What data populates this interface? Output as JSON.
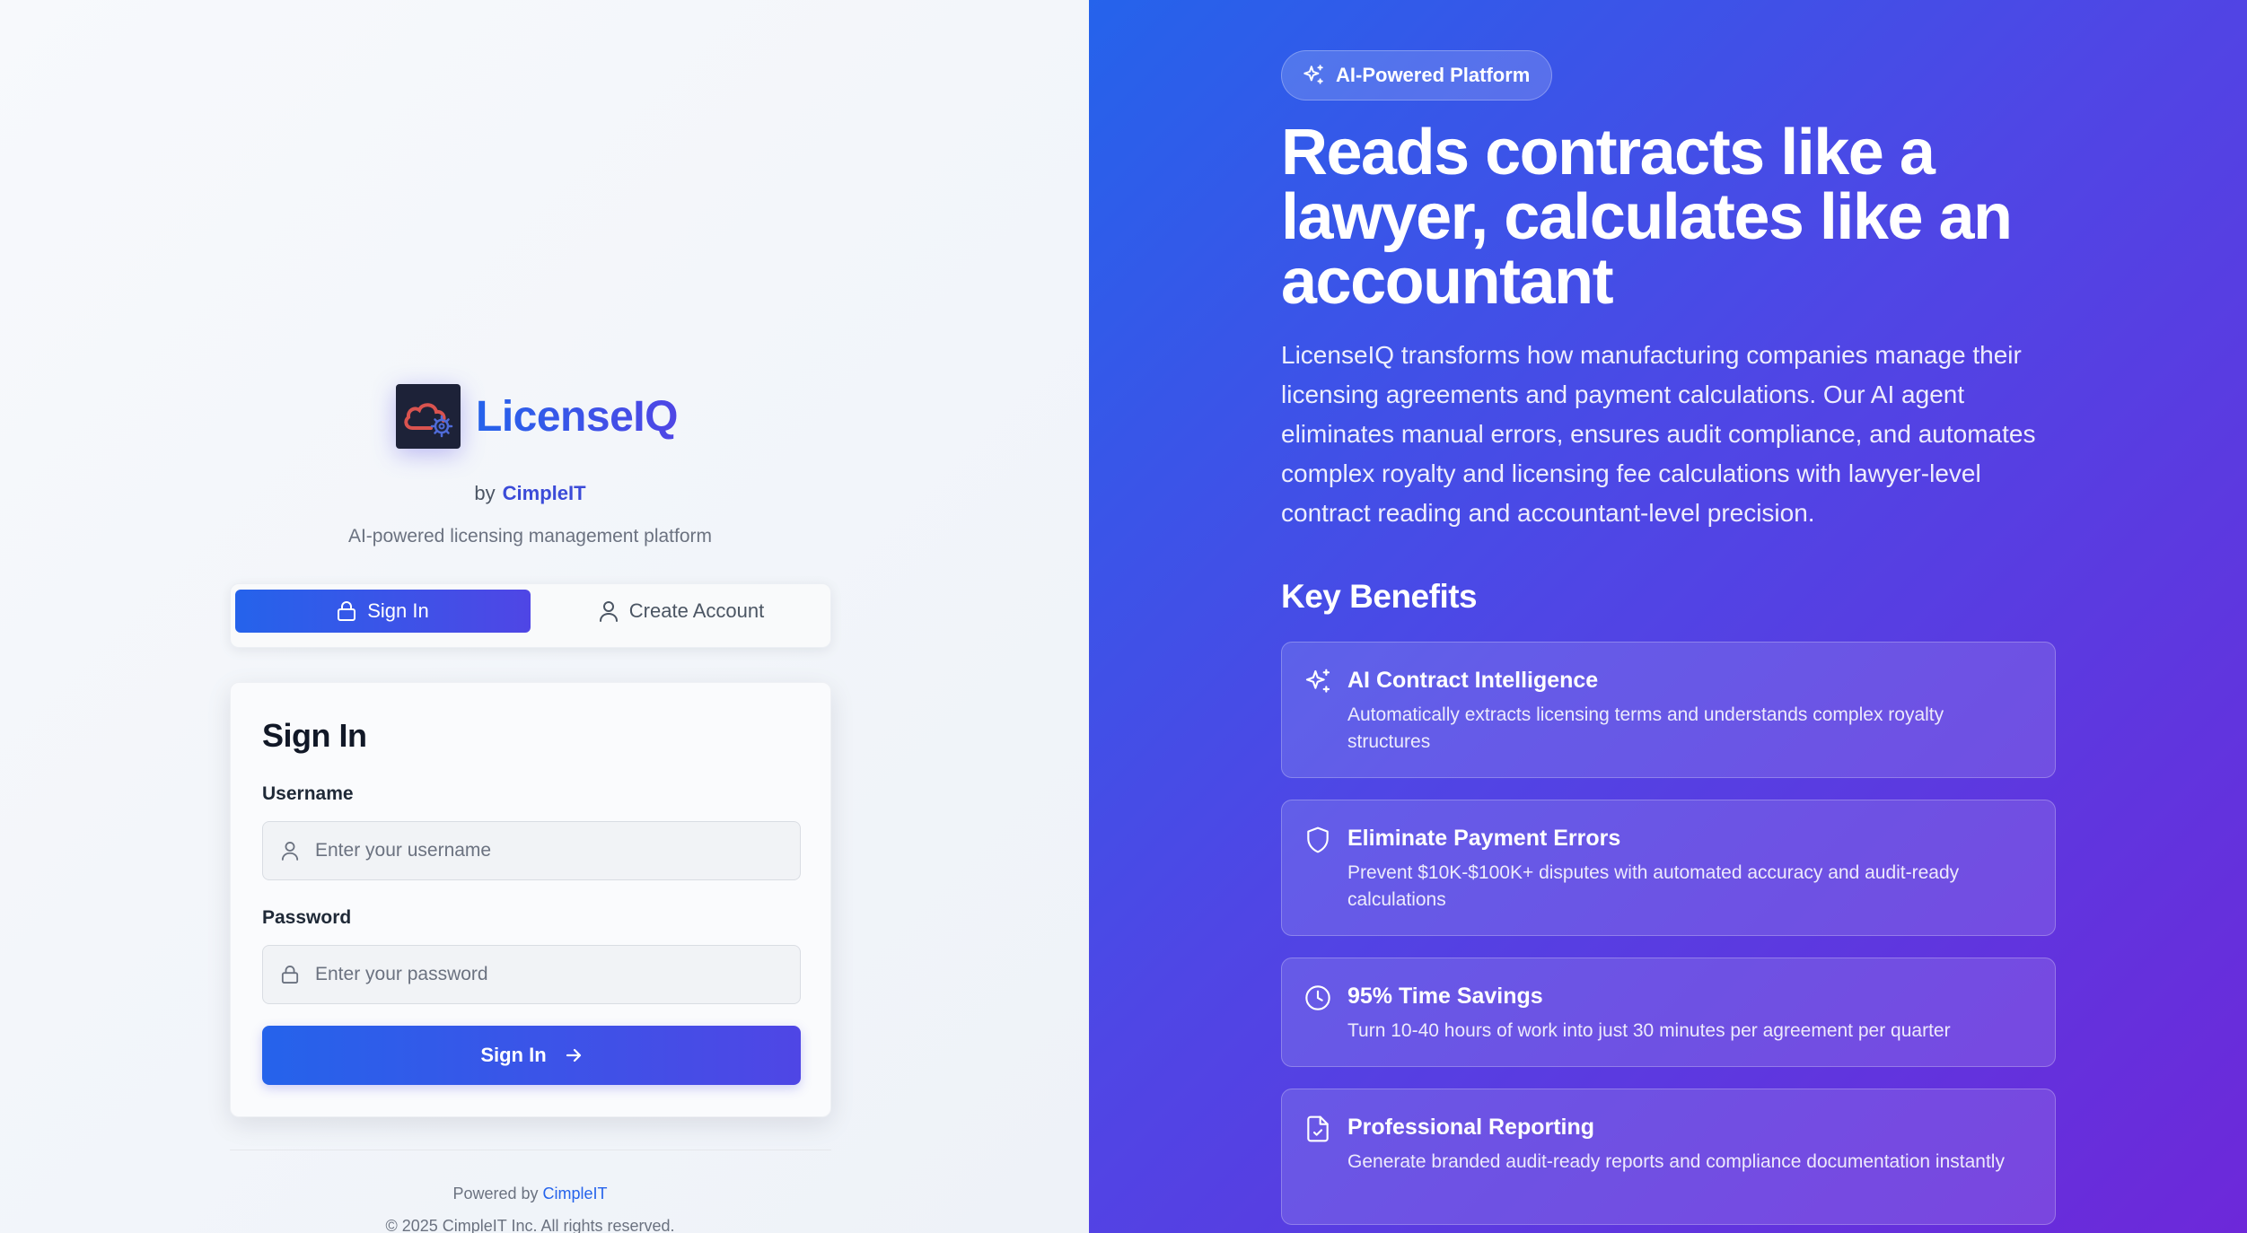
{
  "brand": {
    "name": "LicenseIQ",
    "by_label": "by",
    "company": "CimpleIT",
    "tagline": "AI-powered licensing management platform"
  },
  "auth_tabs": {
    "signin_label": "Sign In",
    "create_label": "Create Account"
  },
  "signin_form": {
    "title": "Sign In",
    "username_label": "Username",
    "username_placeholder": "Enter your username",
    "password_label": "Password",
    "password_placeholder": "Enter your password",
    "submit_label": "Sign In"
  },
  "footer": {
    "powered_by": "Powered by",
    "company": "CimpleIT",
    "copyright": "© 2025 CimpleIT Inc. All rights reserved."
  },
  "hero": {
    "badge": "AI-Powered Platform",
    "headline": "Reads contracts like a lawyer, calculates like an accountant",
    "description": "LicenseIQ transforms how manufacturing companies manage their licensing agreements and payment calculations. Our AI agent eliminates manual errors, ensures audit compliance, and automates complex royalty and licensing fee calculations with lawyer-level contract reading and accountant-level precision.",
    "benefits_title": "Key Benefits",
    "benefits": [
      {
        "icon": "sparkles-icon",
        "title": "AI Contract Intelligence",
        "description": "Automatically extracts licensing terms and understands complex royalty structures"
      },
      {
        "icon": "shield-icon",
        "title": "Eliminate Payment Errors",
        "description": "Prevent $10K-$100K+ disputes with automated accuracy and audit-ready calculations"
      },
      {
        "icon": "clock-icon",
        "title": "95% Time Savings",
        "description": "Turn 10-40 hours of work into just 30 minutes per agreement per quarter"
      },
      {
        "icon": "file-check-icon",
        "title": "Professional Reporting",
        "description": "Generate branded audit-ready reports and compliance documentation instantly"
      }
    ]
  },
  "colors": {
    "accent_start": "#2563eb",
    "accent_end": "#4f46e5",
    "hero_end": "#6d28d9"
  }
}
